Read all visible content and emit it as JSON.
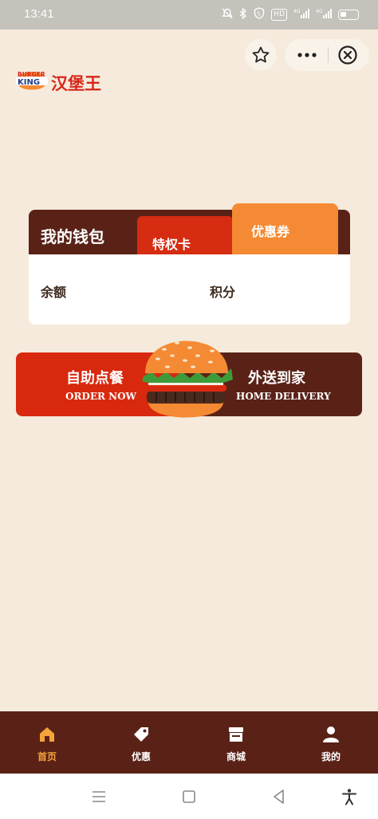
{
  "status_bar": {
    "time": "13:41",
    "hd_badge": "HD",
    "signal_1": "4G",
    "signal_2": "4G"
  },
  "header": {
    "brand_logo_text": "BURGER KING",
    "brand_name": "汉堡王",
    "icons": [
      "star-icon",
      "more-icon",
      "close-icon"
    ]
  },
  "wallet": {
    "title": "我的钱包",
    "tabs": [
      {
        "label": "特权卡",
        "color": "#d62c12"
      },
      {
        "label": "优惠券",
        "color": "#f58a34",
        "selected": true
      }
    ],
    "balance_label": "余额",
    "points_label": "积分"
  },
  "order_banner": {
    "self_order_cn": "自助点餐",
    "self_order_en": "ORDER NOW",
    "delivery_cn": "外送到家",
    "delivery_en": "HOME DELIVERY"
  },
  "tabbar": {
    "items": [
      {
        "label": "首页",
        "icon": "home-icon",
        "active": true
      },
      {
        "label": "优惠",
        "icon": "tag-icon",
        "active": false
      },
      {
        "label": "商城",
        "icon": "store-icon",
        "active": false
      },
      {
        "label": "我的",
        "icon": "user-icon",
        "active": false
      }
    ]
  },
  "colors": {
    "background": "#f5eadb",
    "brand_brown": "#5a2217",
    "brand_red": "#d8290f",
    "brand_orange": "#f58a34",
    "active_tab": "#f5a33a"
  }
}
